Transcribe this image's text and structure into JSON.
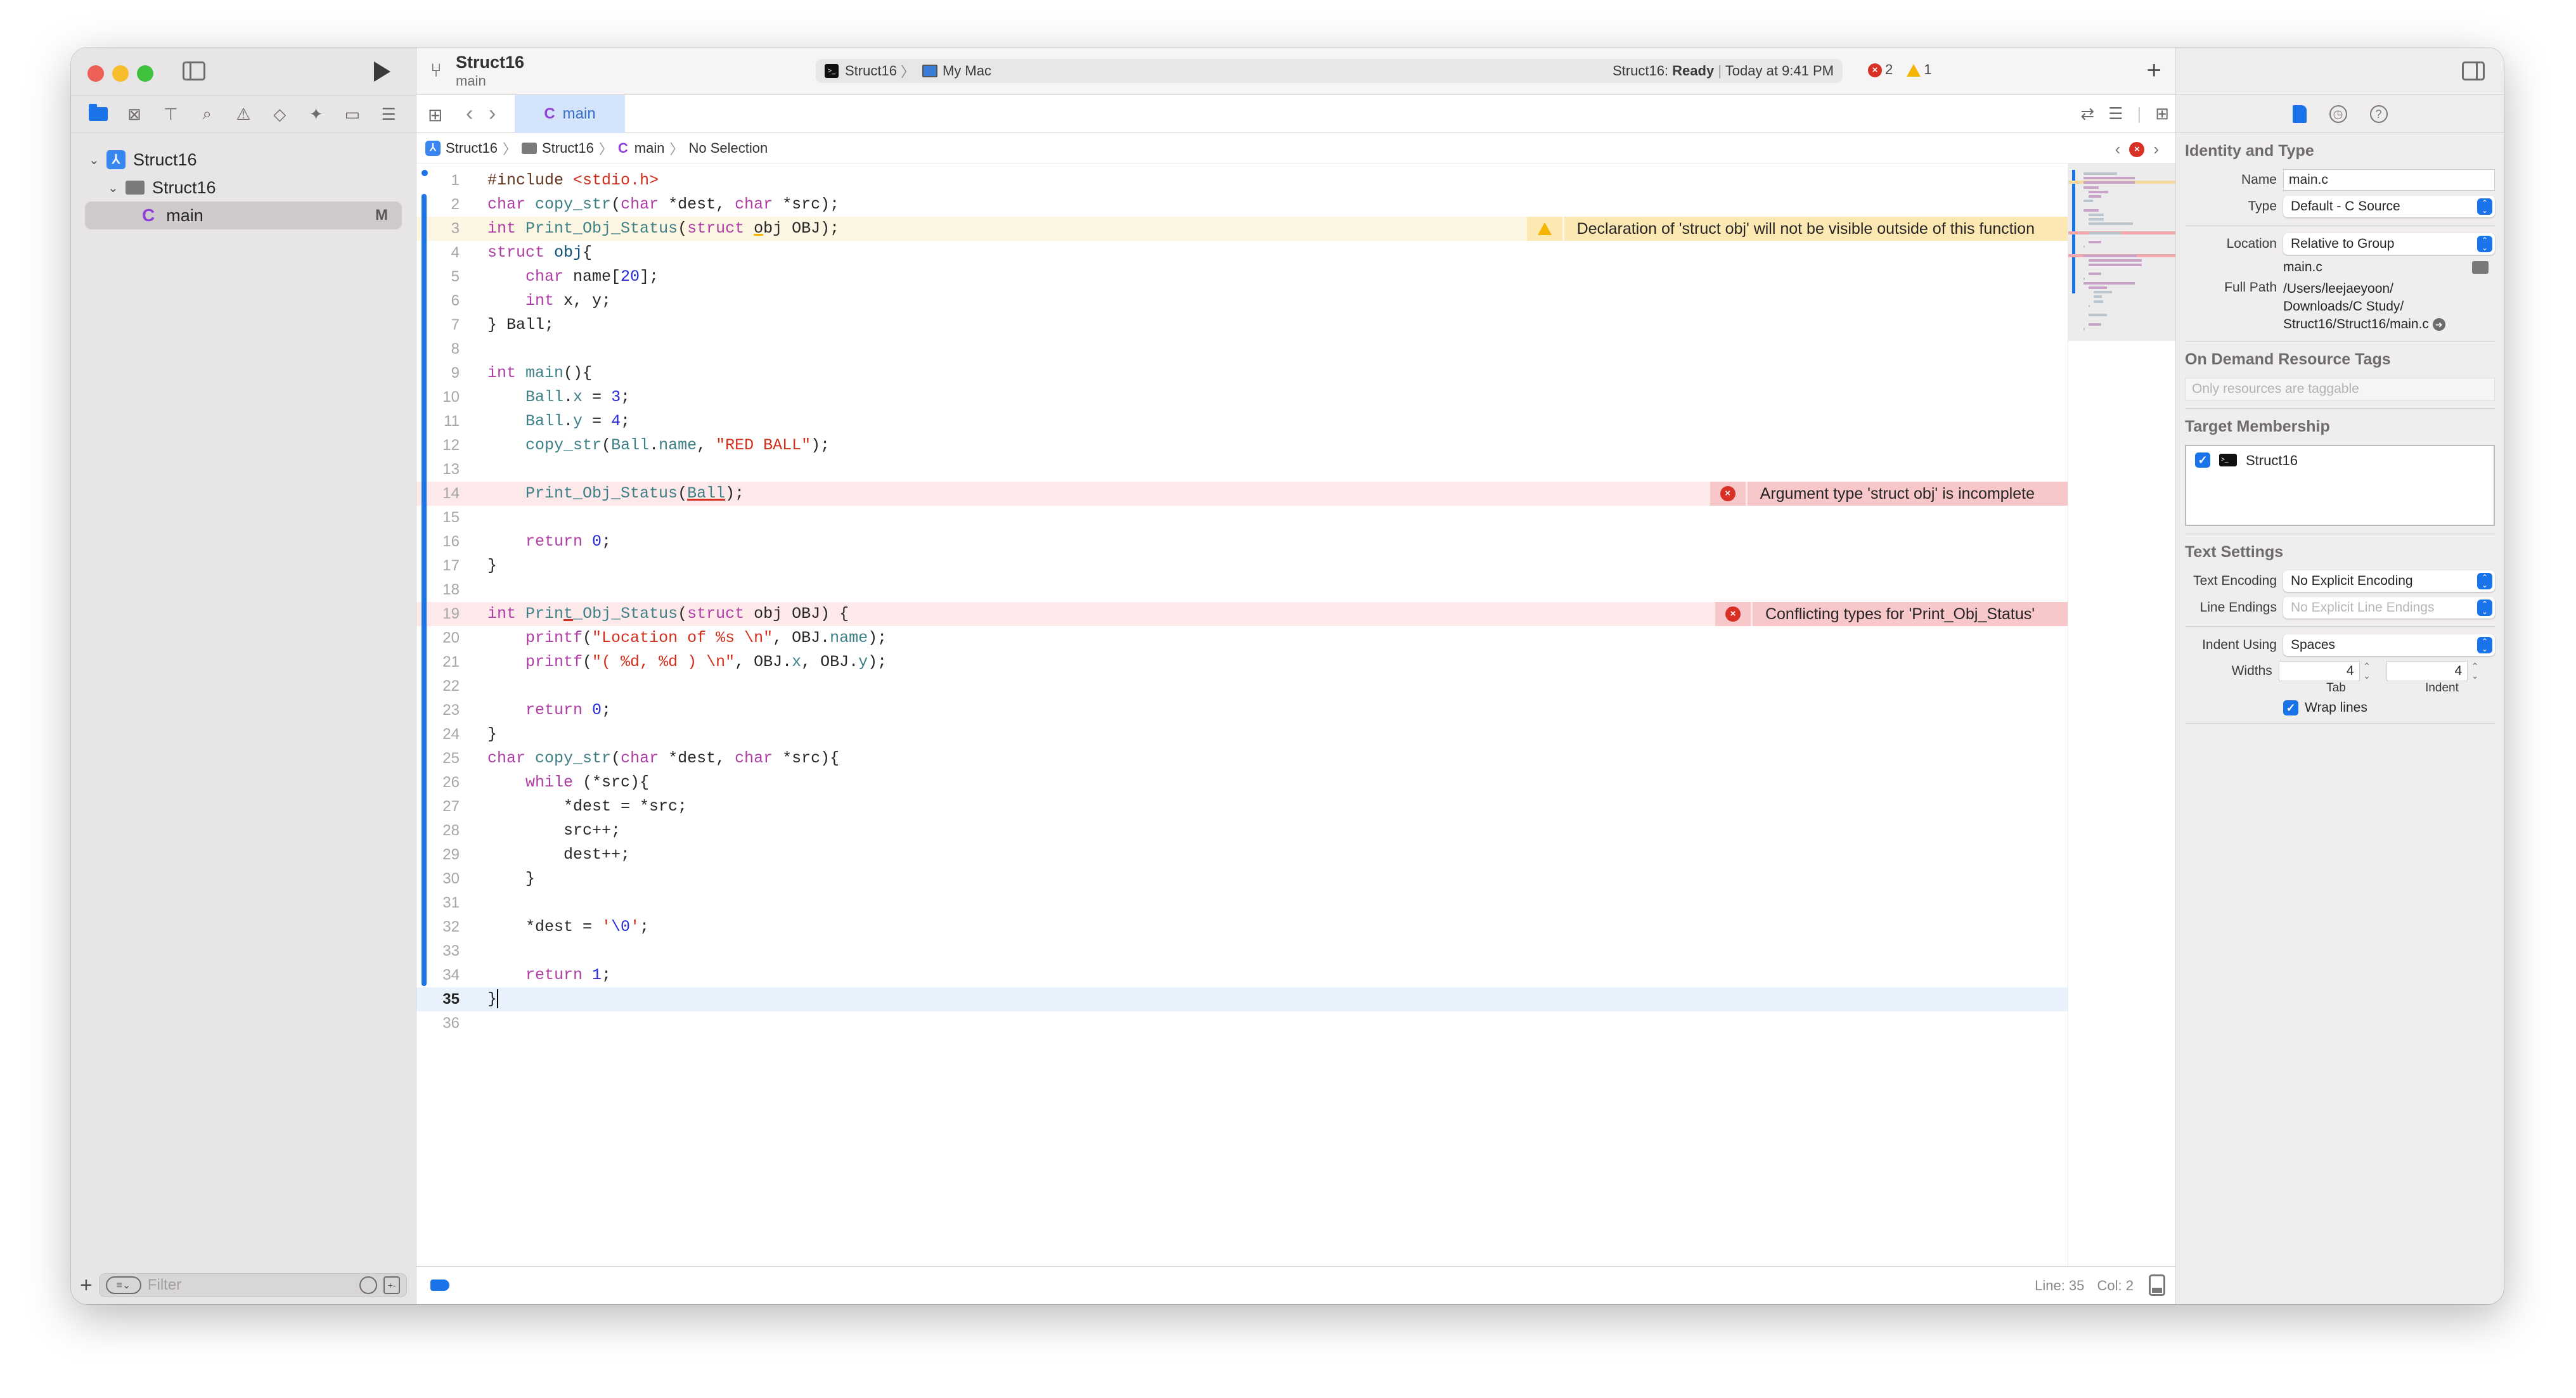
{
  "window": {
    "project_name": "Struct16",
    "branch": "main"
  },
  "activity": {
    "scheme": "Struct16",
    "destination": "My Mac",
    "status_prefix": "Struct16:",
    "status_state": "Ready",
    "status_time": "Today at 9:41 PM",
    "error_count": "2",
    "warning_count": "1"
  },
  "sidebar": {
    "nav_icons": [
      {
        "name": "project-navigator-icon",
        "active": true
      },
      {
        "name": "source-control-navigator-icon",
        "glyph": "⊠"
      },
      {
        "name": "symbol-navigator-icon",
        "glyph": "⊤"
      },
      {
        "name": "find-navigator-icon",
        "glyph": "⌕"
      },
      {
        "name": "issue-navigator-icon",
        "glyph": "⚠"
      },
      {
        "name": "test-navigator-icon",
        "glyph": "◇"
      },
      {
        "name": "debug-navigator-icon",
        "glyph": "✦"
      },
      {
        "name": "breakpoint-navigator-icon",
        "glyph": "▭"
      },
      {
        "name": "report-navigator-icon",
        "glyph": "☰"
      }
    ],
    "tree": {
      "project": "Struct16",
      "group": "Struct16",
      "file": "main",
      "file_badge": "M"
    },
    "filter_placeholder": "Filter"
  },
  "editor": {
    "tab_label": "main",
    "breadcrumb": [
      "Struct16",
      "Struct16",
      "main",
      "No Selection"
    ],
    "cursor": {
      "line": "Line: 35",
      "col": "Col: 2"
    },
    "code_lines": [
      {
        "n": "1",
        "html": "<span class=\"pp\">#include</span> <span class=\"str\">&lt;stdio.h&gt;</span>"
      },
      {
        "n": "2",
        "html": "<span class=\"kw\">char</span> <span class=\"fn\">copy_str</span>(<span class=\"kw\">char</span> *dest, <span class=\"kw\">char</span> *src);"
      },
      {
        "n": "3",
        "html": "<span class=\"kw\">int</span> <span class=\"fn\">Print_Obj_Status</span>(<span class=\"kw\">struct</span> <span class=\"uline-w\">o</span>bj OBJ);",
        "state": "warn"
      },
      {
        "n": "4",
        "html": "<span class=\"kw\">struct</span> <span class=\"ty\">obj</span>{"
      },
      {
        "n": "5",
        "html": "    <span class=\"kw\">char</span> name[<span class=\"num\">20</span>];"
      },
      {
        "n": "6",
        "html": "    <span class=\"kw\">int</span> x, y;"
      },
      {
        "n": "7",
        "html": "} Ball;"
      },
      {
        "n": "8",
        "html": ""
      },
      {
        "n": "9",
        "html": "<span class=\"kw\">int</span> <span class=\"fn\">main</span>(){"
      },
      {
        "n": "10",
        "html": "    <span class=\"mem\">Ball</span>.<span class=\"mem\">x</span> = <span class=\"num\">3</span>;"
      },
      {
        "n": "11",
        "html": "    <span class=\"mem\">Ball</span>.<span class=\"mem\">y</span> = <span class=\"num\">4</span>;"
      },
      {
        "n": "12",
        "html": "    <span class=\"fn\">copy_str</span>(<span class=\"mem\">Ball</span>.<span class=\"mem\">name</span>, <span class=\"str\">\"RED BALL\"</span>);"
      },
      {
        "n": "13",
        "html": ""
      },
      {
        "n": "14",
        "html": "    <span class=\"fn\">Print_Obj_Status</span>(<span class=\"mem uline-e\">Ball</span>);",
        "state": "err"
      },
      {
        "n": "15",
        "html": ""
      },
      {
        "n": "16",
        "html": "    <span class=\"kw\">return</span> <span class=\"num\">0</span>;"
      },
      {
        "n": "17",
        "html": "}"
      },
      {
        "n": "18",
        "html": ""
      },
      {
        "n": "19",
        "html": "<span class=\"kw\">int</span> <span class=\"fn\">Prin<span class=\"uline-e\">t</span>_Obj_Status</span>(<span class=\"kw\">struct</span> obj OBJ) {",
        "state": "err"
      },
      {
        "n": "20",
        "html": "    <span class=\"kw\">printf</span>(<span class=\"str\">\"Location of %s \\n\"</span>, OBJ.<span class=\"mem\">name</span>);"
      },
      {
        "n": "21",
        "html": "    <span class=\"kw\">printf</span>(<span class=\"str\">\"( %d, %d ) \\n\"</span>, OBJ.<span class=\"mem\">x</span>, OBJ.<span class=\"mem\">y</span>);"
      },
      {
        "n": "22",
        "html": ""
      },
      {
        "n": "23",
        "html": "    <span class=\"kw\">return</span> <span class=\"num\">0</span>;"
      },
      {
        "n": "24",
        "html": "}"
      },
      {
        "n": "25",
        "html": "<span class=\"kw\">char</span> <span class=\"fn\">copy_str</span>(<span class=\"kw\">char</span> *dest, <span class=\"kw\">char</span> *src){"
      },
      {
        "n": "26",
        "html": "    <span class=\"kw\">while</span> (*src){"
      },
      {
        "n": "27",
        "html": "        *dest = *src;"
      },
      {
        "n": "28",
        "html": "        src++;"
      },
      {
        "n": "29",
        "html": "        dest++;"
      },
      {
        "n": "30",
        "html": "    }"
      },
      {
        "n": "31",
        "html": ""
      },
      {
        "n": "32",
        "html": "    *dest = <span class=\"str\">'</span><span class=\"num\">\\0</span><span class=\"str\">'</span>;"
      },
      {
        "n": "33",
        "html": ""
      },
      {
        "n": "34",
        "html": "    <span class=\"kw\">return</span> <span class=\"num\">1</span>;"
      },
      {
        "n": "35",
        "html": "}<span class=\"cursor\"></span>",
        "state": "current"
      },
      {
        "n": "36",
        "html": ""
      }
    ],
    "annotations": [
      {
        "line": "3",
        "kind": "warning",
        "message": "Declaration of 'struct obj' will not be visible outside of this function"
      },
      {
        "line": "14",
        "kind": "error",
        "message": "Argument type 'struct obj' is incomplete"
      },
      {
        "line": "19",
        "kind": "error",
        "message": "Conflicting types for 'Print_Obj_Status'"
      }
    ]
  },
  "inspector": {
    "identity": {
      "title": "Identity and Type",
      "name_label": "Name",
      "name_value": "main.c",
      "type_label": "Type",
      "type_value": "Default - C Source",
      "location_label": "Location",
      "location_value": "Relative to Group",
      "file_name": "main.c",
      "full_path_label": "Full Path",
      "full_path_lines": [
        "/Users/leejaeyoon/",
        "Downloads/C Study/",
        "Struct16/Struct16/main.c"
      ]
    },
    "tags": {
      "title": "On Demand Resource Tags",
      "placeholder": "Only resources are taggable"
    },
    "membership": {
      "title": "Target Membership",
      "target": "Struct16",
      "checked": true
    },
    "text_settings": {
      "title": "Text Settings",
      "encoding_label": "Text Encoding",
      "encoding_value": "No Explicit Encoding",
      "line_endings_label": "Line Endings",
      "line_endings_value": "No Explicit Line Endings",
      "indent_label": "Indent Using",
      "indent_value": "Spaces",
      "widths_label": "Widths",
      "tab_width": "4",
      "indent_width": "4",
      "tab_caption": "Tab",
      "indent_caption": "Indent",
      "wrap_label": "Wrap lines",
      "wrap_checked": true
    }
  },
  "colors": {
    "accent": "#1a73e8",
    "error": "#d93025",
    "warning": "#f5b400",
    "error_banner": "#f8c7c9",
    "warning_banner": "#fce8b2"
  }
}
